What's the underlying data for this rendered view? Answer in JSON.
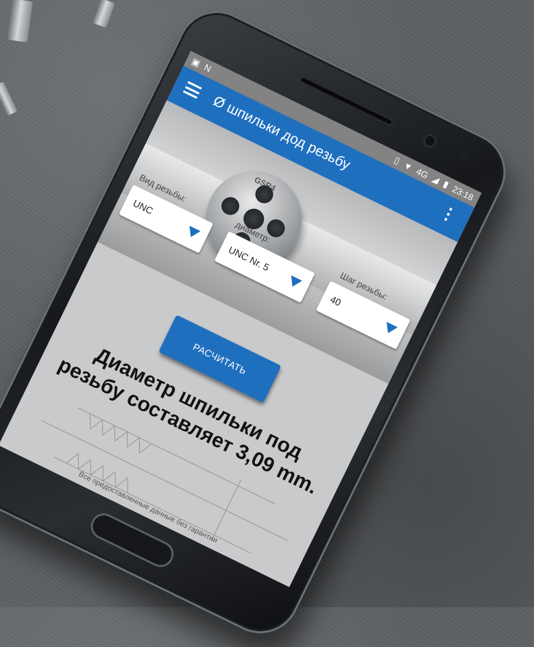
{
  "status_bar": {
    "signal_label": "4G",
    "time": "23:18"
  },
  "app_bar": {
    "title": "Ø шпильки дод резьбу"
  },
  "hero": {
    "die_marking": "GSR4"
  },
  "form": {
    "thread_type": {
      "label": "Вид резьбы:",
      "value": "UNC"
    },
    "diameter": {
      "label": "диаметр:",
      "value": "UNC Nr. 5"
    },
    "pitch": {
      "label": "Шаг резьбы:",
      "value": "40"
    },
    "calculate_button": "РАСЧИТАТЬ"
  },
  "result": {
    "text": "Диаметр шпильки под резьбу составляет 3,09 mm."
  },
  "footer": {
    "disclaimer": "Все предоставленные данные без гарантии"
  },
  "colors": {
    "primary": "#1f6fbf",
    "screen_bg": "#c9cacb"
  }
}
